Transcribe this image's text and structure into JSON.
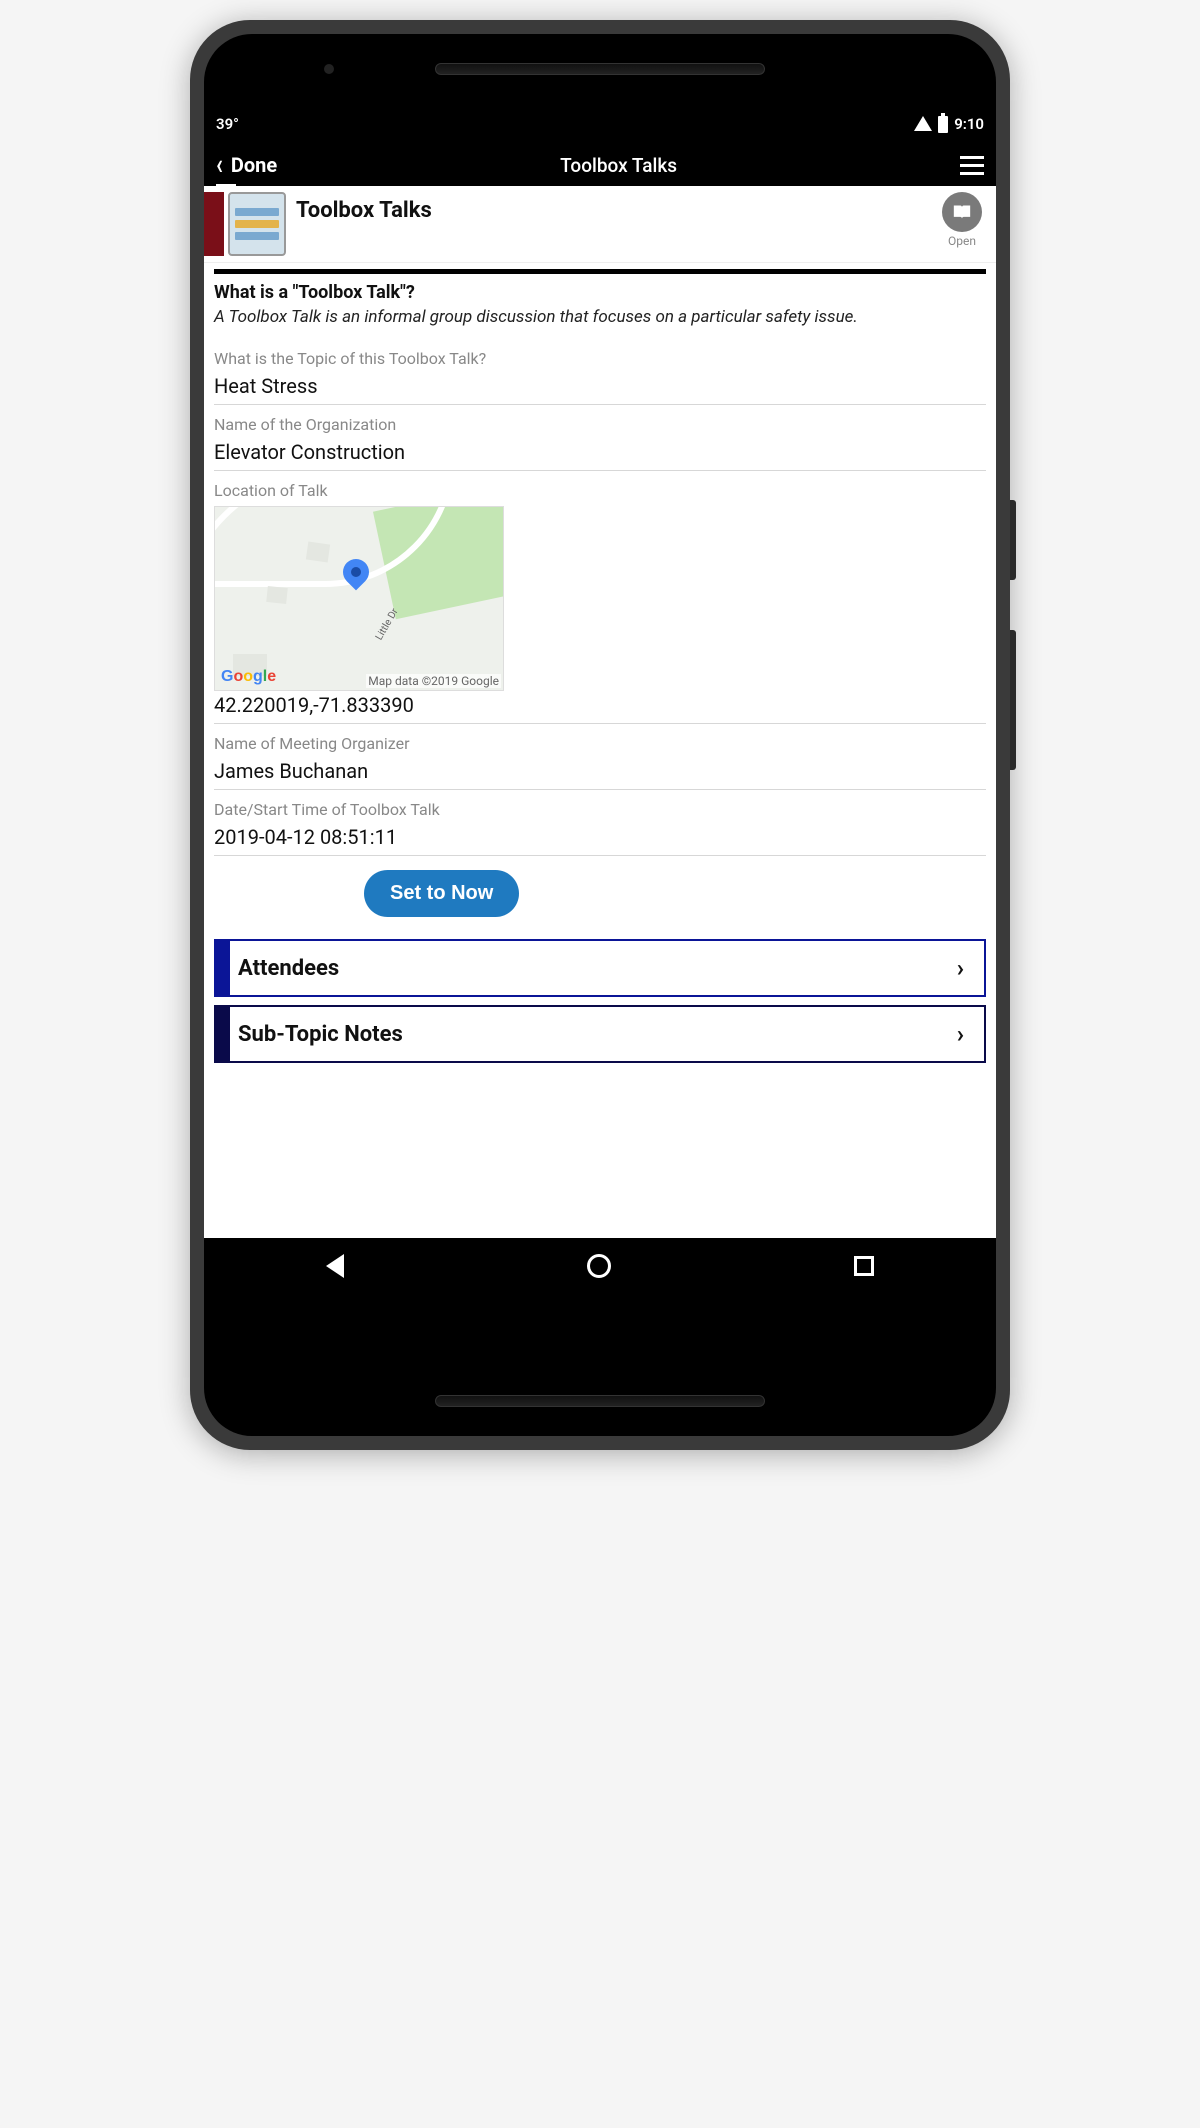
{
  "statusbar": {
    "temp": "39°",
    "time": "9:10"
  },
  "appbar": {
    "done": "Done",
    "title": "Toolbox Talks"
  },
  "formHeader": {
    "title": "Toolbox Talks",
    "open": "Open"
  },
  "intro": {
    "prompt": "What is a \"Toolbox Talk\"?",
    "desc": "A Toolbox Talk is an informal group discussion that focuses on a particular safety issue."
  },
  "fields": {
    "topic": {
      "label": "What is the Topic of this Toolbox Talk?",
      "value": "Heat Stress"
    },
    "org": {
      "label": "Name of the Organization",
      "value": "Elevator Construction"
    },
    "location": {
      "label": "Location of Talk",
      "value": "42.220019,-71.833390",
      "map": {
        "attribution": "Map data ©2019 Google",
        "street": "Little Dr"
      }
    },
    "organizer": {
      "label": "Name of Meeting Organizer",
      "value": "James Buchanan"
    },
    "datetime": {
      "label": "Date/Start Time of Toolbox Talk",
      "value": "2019-04-12 08:51:11"
    }
  },
  "buttons": {
    "setNow": "Set to Now"
  },
  "rows": {
    "attendees": "Attendees",
    "subtopic": "Sub-Topic Notes"
  }
}
